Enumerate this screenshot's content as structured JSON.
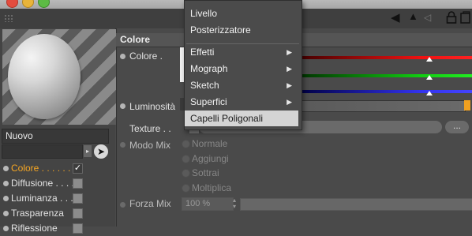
{
  "menu": {
    "items_top": [
      {
        "label": "Livello"
      },
      {
        "label": "Posterizzatore"
      }
    ],
    "items_sub": [
      {
        "label": "Effetti",
        "submenu": "▶"
      },
      {
        "label": "Mograph",
        "submenu": "▶"
      },
      {
        "label": "Sketch",
        "submenu": "▶"
      },
      {
        "label": "Superfici",
        "submenu": "▶"
      }
    ],
    "selected": {
      "label": "Capelli Poligonali"
    }
  },
  "material": {
    "name": "Nuovo"
  },
  "channels": [
    {
      "label": "Colore . . . . . .",
      "checked": true,
      "active": true
    },
    {
      "label": "Diffusione . . . .",
      "checked": false,
      "active": false
    },
    {
      "label": "Luminanza . . .",
      "checked": false,
      "active": false
    },
    {
      "label": "Trasparenza",
      "checked": false,
      "active": false
    },
    {
      "label": "Riflessione",
      "checked": false,
      "active": false
    }
  ],
  "panel": {
    "section_title": "Colore",
    "color_label": "Colore .",
    "luminosity_label": "Luminosità",
    "texture_label": "Texture . .",
    "texture_more": "...",
    "mix_mode_label": "Modo Mix",
    "mix_modes": [
      "Normale",
      "Aggiungi",
      "Sottrai",
      "Moltiplica"
    ],
    "mix_strength_label": "Forza Mix",
    "mix_strength_value": "100 %"
  },
  "colors": {
    "accent_active": "#f5a623",
    "slider_red": "#e11111",
    "slider_green": "#11cc11",
    "slider_blue": "#3333ee"
  },
  "icons": {
    "lock": "lock-icon",
    "new_window": "new-window-icon",
    "nav_back": "arrow-left-icon",
    "nav_up": "arrow-up-icon",
    "nav_forward": "arrow-right-icon",
    "picker": "pointer-icon"
  }
}
